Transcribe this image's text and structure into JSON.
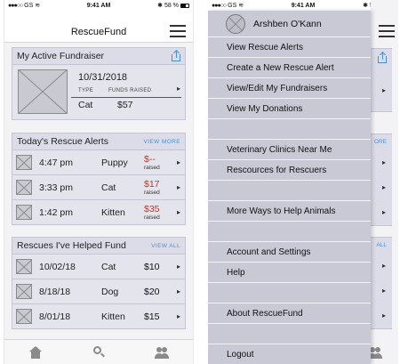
{
  "status_bar": {
    "carrier": "GS",
    "time": "9:41 AM",
    "battery": "58 %"
  },
  "app": {
    "title": "RescueFund"
  },
  "active_fundraiser": {
    "heading": "My Active Fundraiser",
    "date": "10/31/2018",
    "type_label": "TYPE",
    "funds_label": "FUNDS RAISED",
    "type_value": "Cat",
    "funds_value": "$57"
  },
  "rescue_alerts": {
    "heading": "Today's Rescue Alerts",
    "link": "VIEW MORE",
    "raised_label": "raised",
    "rows": [
      {
        "time": "4:47 pm",
        "animal": "Puppy",
        "amount": "$--"
      },
      {
        "time": "3:33 pm",
        "animal": "Cat",
        "amount": "$17"
      },
      {
        "time": "1:42 pm",
        "animal": "Kitten",
        "amount": "$35"
      }
    ]
  },
  "helped_fund": {
    "heading": "Rescues I've Helped Fund",
    "link": "VIEW ALL",
    "rows": [
      {
        "date": "10/02/18",
        "animal": "Cat",
        "amount": "$10"
      },
      {
        "date": "8/18/18",
        "animal": "Dog",
        "amount": "$20"
      },
      {
        "date": "8/01/18",
        "animal": "Kitten",
        "amount": "$15"
      }
    ]
  },
  "drawer": {
    "user_name": "Arshben O'Kann",
    "group1": [
      "View Rescue Alerts",
      "Create a New Rescue Alert",
      "View/Edit My Fundraisers",
      "View My Donations"
    ],
    "group2": [
      "Veterinary Clinics Near Me",
      "Rescources for Rescuers"
    ],
    "group3": [
      "More Ways to Help Animals"
    ],
    "group4": [
      "Account and Settings",
      "Help"
    ],
    "group5": [
      "About RescueFund"
    ],
    "logout": "Logout"
  },
  "peek": {
    "more_link": "ORE",
    "all_link": "ALL"
  },
  "colors": {
    "accent": "#4a8fd6",
    "card_bg": "#dcdce8",
    "drawer_bg": "#c9c9d6",
    "alert_red": "#c0392b"
  }
}
